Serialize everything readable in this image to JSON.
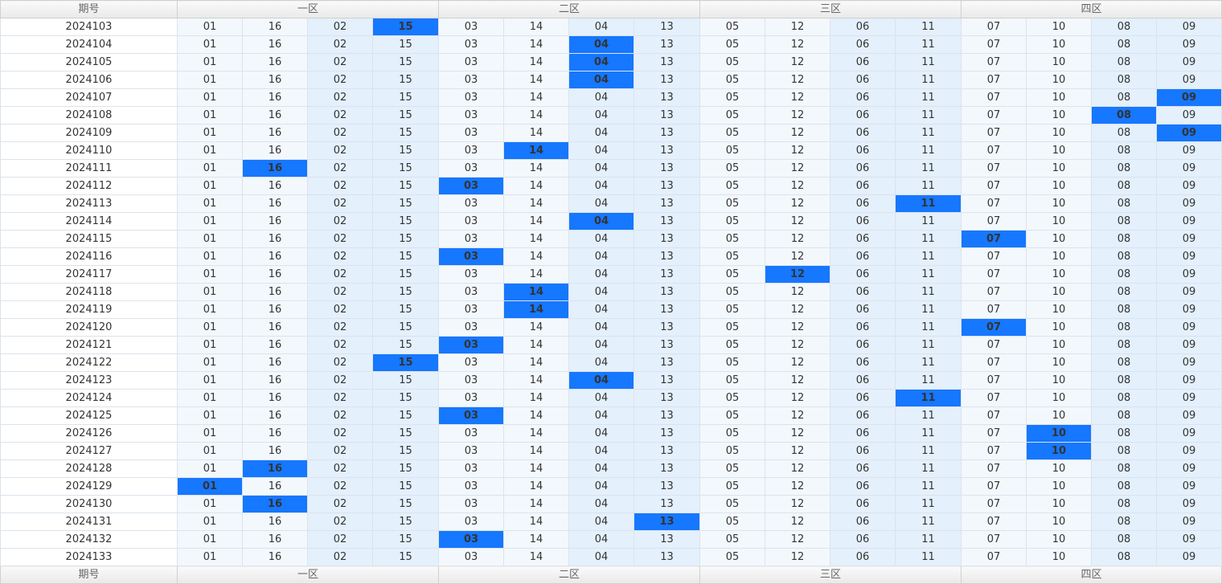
{
  "header": {
    "period_label": "期号",
    "zones": [
      {
        "label": "一区"
      },
      {
        "label": "二区"
      },
      {
        "label": "三区"
      },
      {
        "label": "四区"
      }
    ]
  },
  "column_numbers": [
    "01",
    "16",
    "02",
    "15",
    "03",
    "14",
    "04",
    "13",
    "05",
    "12",
    "06",
    "11",
    "07",
    "10",
    "08",
    "09"
  ],
  "accent_color": "#1677ff",
  "rows": [
    {
      "period": "2024103",
      "hit": 3
    },
    {
      "period": "2024104",
      "hit": 6
    },
    {
      "period": "2024105",
      "hit": 6
    },
    {
      "period": "2024106",
      "hit": 6
    },
    {
      "period": "2024107",
      "hit": 15
    },
    {
      "period": "2024108",
      "hit": 14
    },
    {
      "period": "2024109",
      "hit": 15
    },
    {
      "period": "2024110",
      "hit": 5
    },
    {
      "period": "2024111",
      "hit": 1
    },
    {
      "period": "2024112",
      "hit": 4
    },
    {
      "period": "2024113",
      "hit": 11
    },
    {
      "period": "2024114",
      "hit": 6
    },
    {
      "period": "2024115",
      "hit": 12
    },
    {
      "period": "2024116",
      "hit": 4
    },
    {
      "period": "2024117",
      "hit": 9
    },
    {
      "period": "2024118",
      "hit": 5
    },
    {
      "period": "2024119",
      "hit": 5
    },
    {
      "period": "2024120",
      "hit": 12
    },
    {
      "period": "2024121",
      "hit": 4
    },
    {
      "period": "2024122",
      "hit": 3
    },
    {
      "period": "2024123",
      "hit": 6
    },
    {
      "period": "2024124",
      "hit": 11
    },
    {
      "period": "2024125",
      "hit": 4
    },
    {
      "period": "2024126",
      "hit": 13
    },
    {
      "period": "2024127",
      "hit": 13
    },
    {
      "period": "2024128",
      "hit": 1
    },
    {
      "period": "2024129",
      "hit": 0
    },
    {
      "period": "2024130",
      "hit": 1
    },
    {
      "period": "2024131",
      "hit": 7
    },
    {
      "period": "2024132",
      "hit": 4
    },
    {
      "period": "2024133",
      "hit": -1
    }
  ]
}
